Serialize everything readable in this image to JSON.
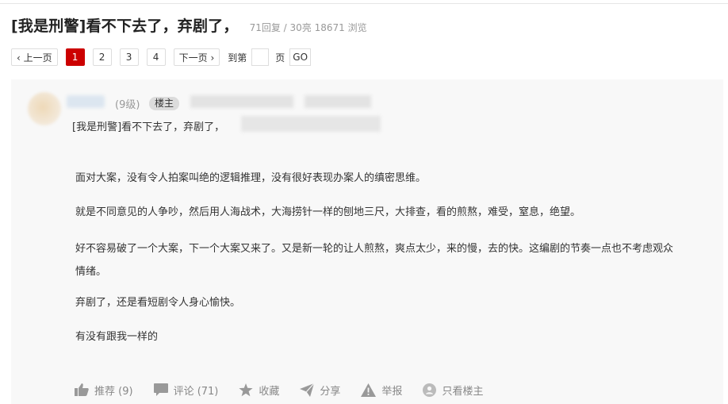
{
  "thread": {
    "title": "[我是刑警]看不下去了，弃剧了，",
    "stats": "71回复 / 30亮 18671 浏览"
  },
  "pagination": {
    "prev_label": "‹ 上一页",
    "pages": [
      "1",
      "2",
      "3",
      "4"
    ],
    "current": "1",
    "next_label": "下一页 ›",
    "goto_prefix": "到第",
    "goto_suffix": "页",
    "go_label": "GO"
  },
  "post": {
    "level": "(9级)",
    "owner_badge": "楼主",
    "subtitle": "[我是刑警]看不下去了，弃剧了，",
    "paragraphs": [
      "面对大案，没有令人拍案叫绝的逻辑推理，没有很好表现办案人的缜密思维。",
      "就是不同意见的人争吵，然后用人海战术，大海捞针一样的刨地三尺，大排查，看的煎熬，难受，窒息，绝望。",
      "好不容易破了一个大案，下一个大案又来了。又是新一轮的让人煎熬，爽点太少，来的慢，去的快。这编剧的节奏一点也不考虑观众情绪。",
      "弃剧了，还是看短剧令人身心愉快。",
      "有没有跟我一样的"
    ]
  },
  "actions": {
    "recommend_label": "推荐 (9)",
    "comment_label": "评论 (71)",
    "favorite_label": "收藏",
    "share_label": "分享",
    "report_label": "举报",
    "owner_only_label": "只看楼主",
    "icons": [
      "thumb-up-icon",
      "comment-icon",
      "star-icon",
      "share-icon",
      "warning-icon",
      "owner-icon"
    ]
  },
  "colors": {
    "accent": "#cc0000",
    "card_bg": "#f8f8f8",
    "muted": "#888888"
  }
}
